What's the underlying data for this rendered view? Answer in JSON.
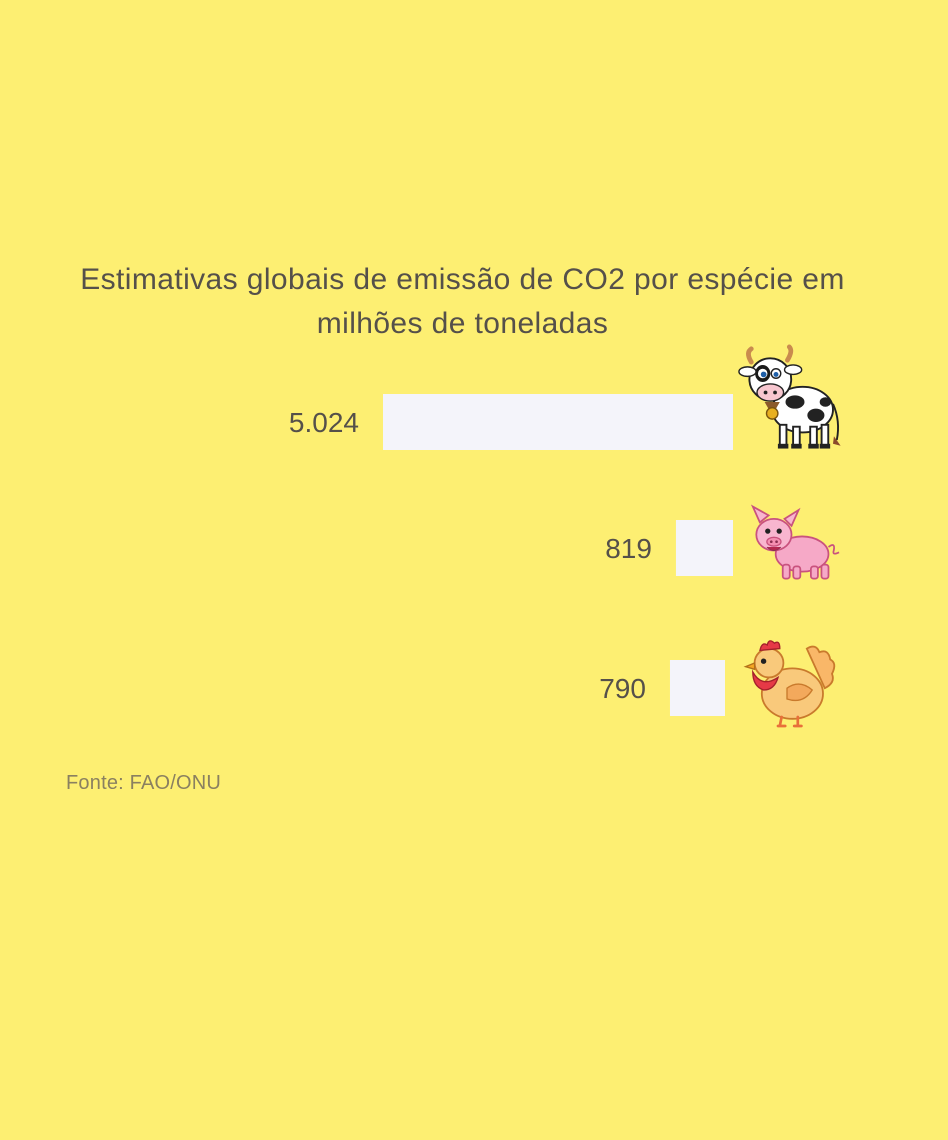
{
  "colors": {
    "background": "#FDEF72",
    "bar": "#F4F4FA",
    "text": "#55504A",
    "source_text": "#8A8060"
  },
  "chart_data": {
    "type": "bar",
    "orientation": "horizontal",
    "title": "Estimativas globais de emissão de CO2 por espécie em milhões de toneladas",
    "categories": [
      "cow-icon",
      "pig-icon",
      "chicken-icon"
    ],
    "values": [
      5024,
      819,
      790
    ],
    "value_labels": [
      "5.024",
      "819",
      "790"
    ],
    "bar_alignment": "right",
    "xlim": [
      0,
      5024
    ],
    "grid": false,
    "legend": "none"
  },
  "source": "Fonte: FAO/ONU"
}
